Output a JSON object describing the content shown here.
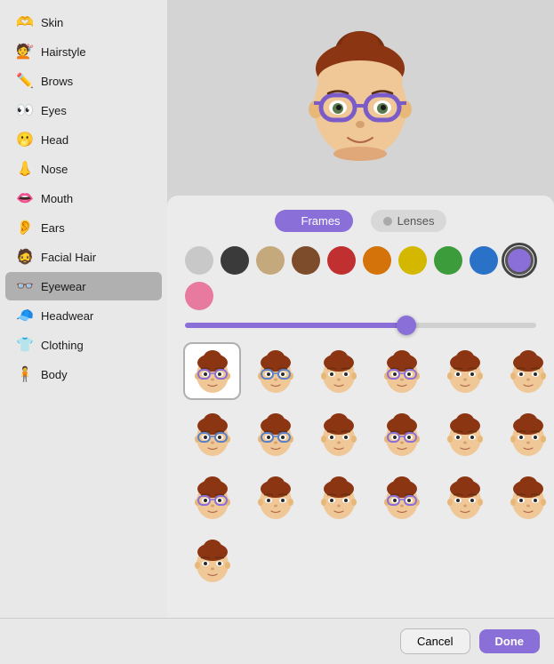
{
  "sidebar": {
    "items": [
      {
        "id": "skin",
        "label": "Skin",
        "icon": "🫶"
      },
      {
        "id": "hairstyle",
        "label": "Hairstyle",
        "icon": "💇"
      },
      {
        "id": "brows",
        "label": "Brows",
        "icon": "✏️"
      },
      {
        "id": "eyes",
        "label": "Eyes",
        "icon": "👀"
      },
      {
        "id": "head",
        "label": "Head",
        "icon": "🫢"
      },
      {
        "id": "nose",
        "label": "Nose",
        "icon": "👃"
      },
      {
        "id": "mouth",
        "label": "Mouth",
        "icon": "👄"
      },
      {
        "id": "ears",
        "label": "Ears",
        "icon": "👂"
      },
      {
        "id": "facial-hair",
        "label": "Facial Hair",
        "icon": "🧔"
      },
      {
        "id": "eyewear",
        "label": "Eyewear",
        "icon": "👓",
        "active": true
      },
      {
        "id": "headwear",
        "label": "Headwear",
        "icon": "🧢"
      },
      {
        "id": "clothing",
        "label": "Clothing",
        "icon": "👕"
      },
      {
        "id": "body",
        "label": "Body",
        "icon": "🧍"
      }
    ]
  },
  "tabs": [
    {
      "id": "frames",
      "label": "Frames",
      "active": true
    },
    {
      "id": "lenses",
      "label": "Lenses",
      "active": false
    }
  ],
  "colors": [
    {
      "id": "light-gray",
      "hex": "#c8c8c8",
      "selected": false
    },
    {
      "id": "dark-gray",
      "hex": "#3a3a3a",
      "selected": false
    },
    {
      "id": "tan",
      "hex": "#c4a97c",
      "selected": false
    },
    {
      "id": "brown",
      "hex": "#7d4c2a",
      "selected": false
    },
    {
      "id": "red",
      "hex": "#c03030",
      "selected": false
    },
    {
      "id": "orange",
      "hex": "#d4730a",
      "selected": false
    },
    {
      "id": "yellow",
      "hex": "#d4b800",
      "selected": false
    },
    {
      "id": "green",
      "hex": "#3c9c3c",
      "selected": false
    },
    {
      "id": "blue",
      "hex": "#2a72c8",
      "selected": false
    },
    {
      "id": "purple",
      "hex": "#8a6fd8",
      "selected": true
    },
    {
      "id": "pink",
      "hex": "#e87aa0",
      "selected": false
    }
  ],
  "slider": {
    "value": 63,
    "min": 0,
    "max": 100
  },
  "buttons": {
    "cancel": "Cancel",
    "done": "Done"
  },
  "grid_rows": 4,
  "grid_cols": 6
}
